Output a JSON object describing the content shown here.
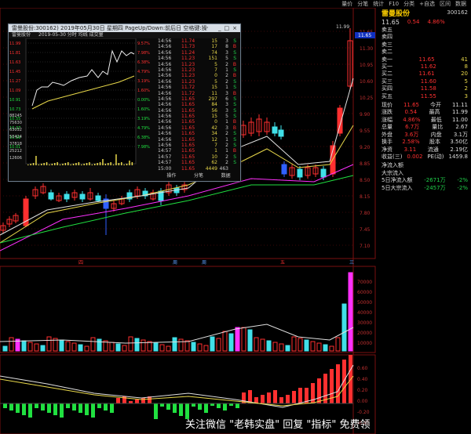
{
  "menu": [
    "量价",
    "分笔",
    "统计",
    "F10",
    "分类",
    "+自选",
    "区间",
    "数据"
  ],
  "stock": {
    "name": "雷曼股份",
    "code": "300162",
    "price": "11.65",
    "change": "0.54",
    "chg_pct": "4.86%"
  },
  "main_chart": {
    "price_high": "11.99",
    "price_tag": "11.65",
    "y_labels": [
      "11.65",
      "11.30",
      "10.95",
      "10.60",
      "10.25",
      "9.90",
      "9.55",
      "9.20",
      "8.85",
      "8.50",
      "8.15",
      "7.80",
      "7.45",
      "7.10"
    ],
    "vol_labels": [
      "70000",
      "60000",
      "50000",
      "40000",
      "30000",
      "20000",
      "10000"
    ],
    "macd_labels": [
      "0.60",
      "0.40",
      "0.20",
      "0.00",
      "-0.20",
      "-0.40"
    ],
    "markers": [
      "周",
      "五",
      "三",
      "四",
      "周"
    ],
    "colors": {
      "up": "#ff3030",
      "down": "#40e0e8",
      "dropped": "#3060ff",
      "magenta": "#ff30ff",
      "yellow": "#e8d84a",
      "white": "#e0e0e0",
      "green": "#20e040"
    }
  },
  "side": {
    "orders": [
      {
        "label": "卖五",
        "p": "",
        "v": ""
      },
      {
        "label": "卖四",
        "p": "",
        "v": ""
      },
      {
        "label": "卖三",
        "p": "",
        "v": ""
      },
      {
        "label": "卖二",
        "p": "",
        "v": ""
      },
      {
        "label": "卖一",
        "p": "11.65",
        "v": "41"
      },
      {
        "label": "买一",
        "p": "11.62",
        "v": "8"
      },
      {
        "label": "买二",
        "p": "11.61",
        "v": "20"
      },
      {
        "label": "买三",
        "p": "11.60",
        "v": "5"
      },
      {
        "label": "买四",
        "p": "11.58",
        "v": "2"
      },
      {
        "label": "买五",
        "p": "11.55",
        "v": "3"
      }
    ],
    "stats": [
      {
        "label": "现价",
        "v": "11.65",
        "label2": "今开",
        "v2": "11.11"
      },
      {
        "label": "涨跌",
        "v": "0.54",
        "label2": "最高",
        "v2": "11.99"
      },
      {
        "label": "涨幅",
        "v": "4.86%",
        "label2": "最低",
        "v2": "11.00"
      },
      {
        "label": "总量",
        "v": "6.7万",
        "label2": "量比",
        "v2": "2.67"
      },
      {
        "label": "外盘",
        "v": "3.6万",
        "label2": "内盘",
        "v2": "3.1万"
      },
      {
        "label": "换手",
        "v": "2.58%",
        "label2": "股本",
        "v2": "3.50亿"
      },
      {
        "label": "净资",
        "v": "3.11",
        "label2": "流通",
        "v2": "2.19亿"
      },
      {
        "label": "收益(三)",
        "v": "0.002",
        "label2": "PE(动)",
        "v2": "1459.8"
      }
    ],
    "flow": [
      {
        "label": "净流入额",
        "v": "",
        "pct": ""
      },
      {
        "label": "大宗流入",
        "v": "",
        "pct": ""
      },
      {
        "label": "5日净流入额",
        "v": "-2671万",
        "pct": "-2%"
      },
      {
        "label": "5日大宗流入",
        "v": "-2457万",
        "pct": "-2%"
      }
    ]
  },
  "popup": {
    "title": "雷曼股份:300162) 2019年05月30日 星期四 PageUp/Down:前后日 空格键:操作 [退出请按]",
    "win_btns": [
      "_",
      "□",
      "×"
    ],
    "sub": [
      "雷曼股份",
      "2019-05-30 分时 均线 成交量"
    ],
    "y_left": [
      "11.99",
      "11.81",
      "11.63",
      "11.45",
      "11.27",
      "11.09",
      "10.91",
      "10.73",
      "10.55",
      "10.37",
      "10.19",
      "10.01"
    ],
    "y_right": [
      "9.57%",
      "7.98%",
      "6.38%",
      "4.79%",
      "3.19%",
      "1.60%",
      "0.00%",
      "1.60%",
      "3.19%",
      "4.79%",
      "6.38%",
      "7.98%"
    ],
    "vol_labels": [
      "88245",
      "75630",
      "63032",
      "50424",
      "37818",
      "25212",
      "12606"
    ],
    "ticks": [
      {
        "t": "14:56",
        "p": "11.74",
        "v": "15",
        "n": "3",
        "d": "S"
      },
      {
        "t": "14:56",
        "p": "11.73",
        "v": "17",
        "n": "8",
        "d": "B"
      },
      {
        "t": "14:56",
        "p": "11.24",
        "v": "74",
        "n": "3",
        "d": "S"
      },
      {
        "t": "14:56",
        "p": "11.23",
        "v": "151",
        "n": "5",
        "d": "S"
      },
      {
        "t": "14:56",
        "p": "11.23",
        "v": "5",
        "n": "2",
        "d": "B"
      },
      {
        "t": "14:56",
        "p": "11.23",
        "v": "7",
        "n": "1",
        "d": "S"
      },
      {
        "t": "14:56",
        "p": "11.23",
        "v": "0",
        "n": "2",
        "d": "B"
      },
      {
        "t": "14:56",
        "p": "11.23",
        "v": "5",
        "n": "2",
        "d": "S"
      },
      {
        "t": "14:56",
        "p": "11.72",
        "v": "15",
        "n": "1",
        "d": "S"
      },
      {
        "t": "14:56",
        "p": "11.72",
        "v": "11",
        "n": "3",
        "d": "B"
      },
      {
        "t": "14:56",
        "p": "11.65",
        "v": "297",
        "n": "6",
        "d": "S"
      },
      {
        "t": "14:56",
        "p": "11.65",
        "v": "84",
        "n": "3",
        "d": "S"
      },
      {
        "t": "14:56",
        "p": "11.65",
        "v": "56",
        "n": "3",
        "d": "S"
      },
      {
        "t": "14:56",
        "p": "11.65",
        "v": "15",
        "n": "5",
        "d": "S"
      },
      {
        "t": "14:56",
        "p": "11.65",
        "v": "0",
        "n": "1",
        "d": "B"
      },
      {
        "t": "14:56",
        "p": "11.65",
        "v": "42",
        "n": "3",
        "d": "B"
      },
      {
        "t": "14:56",
        "p": "11.65",
        "v": "34",
        "n": "2",
        "d": "S"
      },
      {
        "t": "14:56",
        "p": "11.65",
        "v": "12",
        "n": "1",
        "d": "S"
      },
      {
        "t": "14:56",
        "p": "11.65",
        "v": "7",
        "n": "2",
        "d": "S"
      },
      {
        "t": "14:57",
        "p": "11.65",
        "v": "1",
        "n": "1",
        "d": "B"
      },
      {
        "t": "14:57",
        "p": "11.65",
        "v": "10",
        "n": "2",
        "d": "S"
      },
      {
        "t": "14:57",
        "p": "11.65",
        "v": "62",
        "n": "2",
        "d": "S"
      },
      {
        "t": "15:00",
        "p": "11.65",
        "v": "4449",
        "n": "463",
        "d": ""
      }
    ],
    "footer": [
      "操作",
      "分笔",
      "数据"
    ]
  },
  "watermark": "关注微信 \"老韩实盘\" 回复 \"指标\" 免费领"
}
